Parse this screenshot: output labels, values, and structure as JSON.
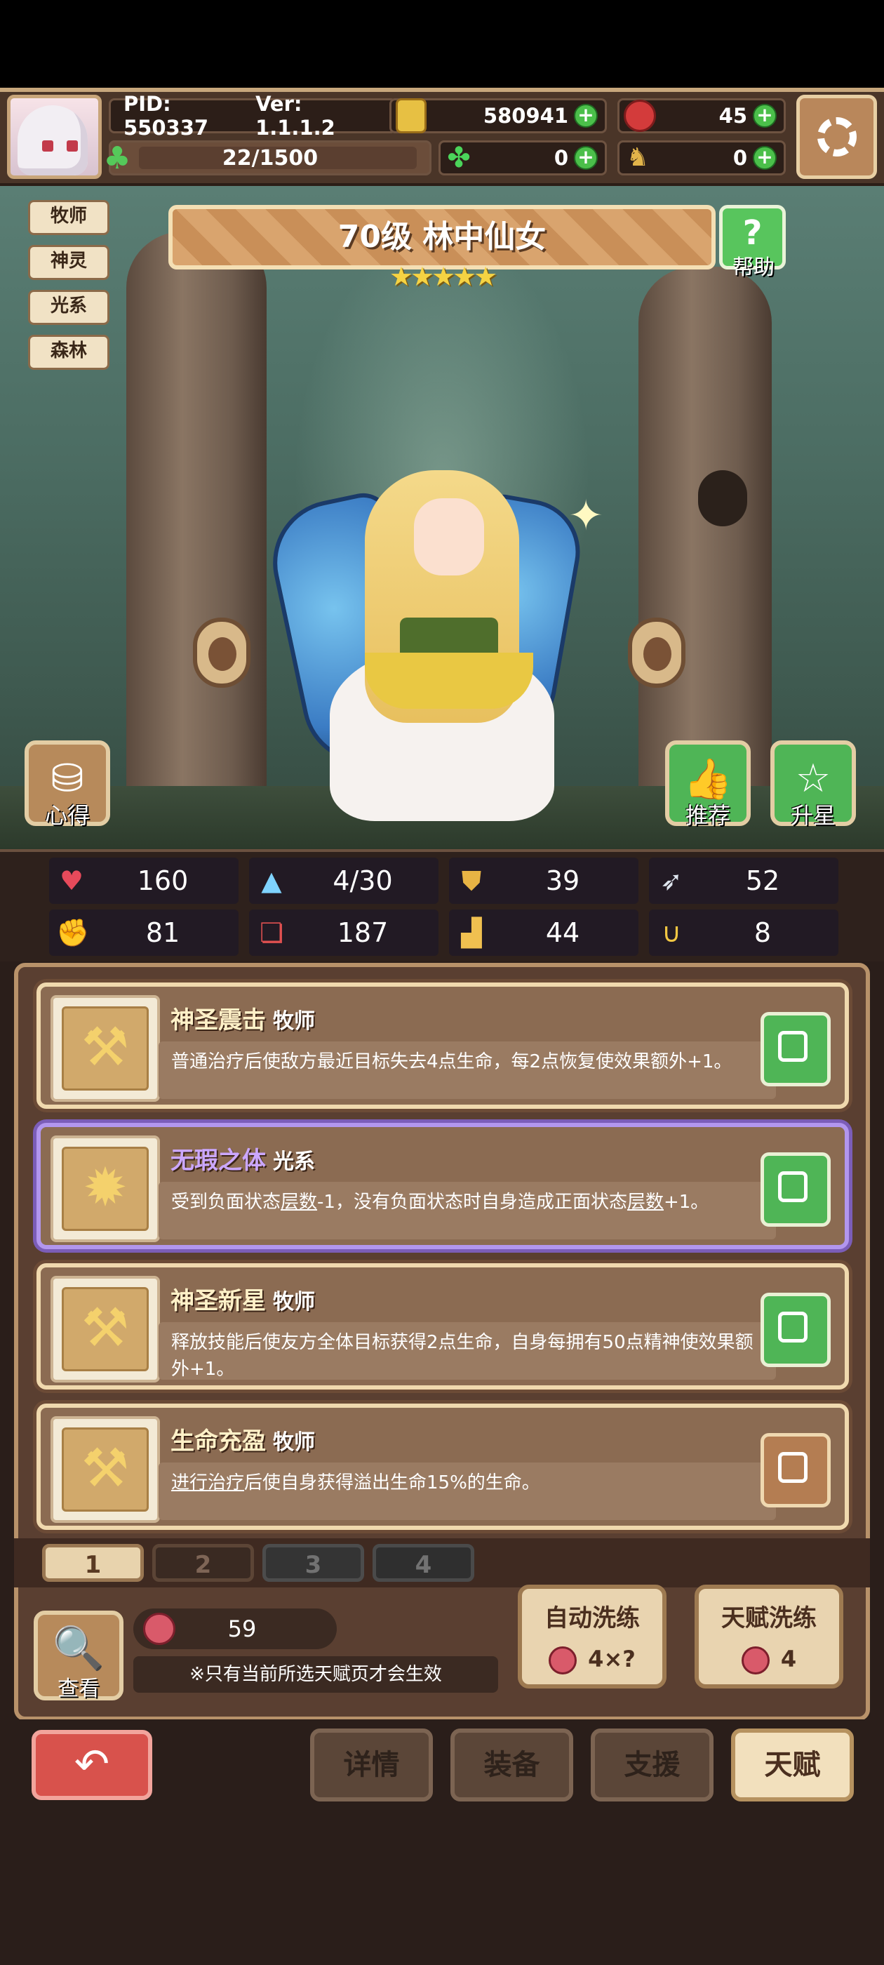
{
  "header": {
    "pid": "PID: 550337",
    "version": "Ver: 1.1.1.2",
    "coins": "580941",
    "gems": "45",
    "xp": "22/1500",
    "clovers": "0",
    "horseshoes": "0"
  },
  "tags": [
    "牧师",
    "神灵",
    "光系",
    "森林"
  ],
  "hero": {
    "title": "70级 林中仙女",
    "stars": "★★★★★",
    "help": "帮助"
  },
  "scene_buttons": {
    "xinde": "心得",
    "tuijian": "推荐",
    "shengxing": "升星"
  },
  "stats": [
    {
      "icon": "heart-icon",
      "value": "160"
    },
    {
      "icon": "water-drop-icon",
      "value": "4/30"
    },
    {
      "icon": "shield-icon",
      "value": "39"
    },
    {
      "icon": "wing-icon",
      "value": "52"
    },
    {
      "icon": "fist-icon",
      "value": "81"
    },
    {
      "icon": "book-icon",
      "value": "187"
    },
    {
      "icon": "boot-icon",
      "value": "44"
    },
    {
      "icon": "magnet-icon",
      "value": "8"
    }
  ],
  "talents": [
    {
      "name": "神圣震击",
      "type": "牧师",
      "desc": "普通治疗后使敌方最近目标失去4点生命，每2点恢复使效果额外+1。"
    },
    {
      "name": "无瑕之体",
      "type": "光系",
      "desc_a": "受到负面状态",
      "desc_b": "层数",
      "desc_c": "-1，没有负面状态时自身造成正面状态",
      "desc_d": "层数",
      "desc_e": "+1。"
    },
    {
      "name": "神圣新星",
      "type": "牧师",
      "desc": "释放技能后使友方全体目标获得2点生命，自身每拥有50点精神使效果额外+1。"
    },
    {
      "name": "生命充盈",
      "type": "牧师",
      "desc_a": "进行治疗",
      "desc_b": "后使自身获得溢出生命15%的生命。"
    }
  ],
  "pages": [
    "1",
    "2",
    "3",
    "4"
  ],
  "bottom_panel": {
    "view": "查看",
    "fruit_count": "59",
    "note": "※只有当前所选天赋页才会生效",
    "auto_reroll": {
      "label": "自动洗练",
      "cost": "4×?"
    },
    "talent_reroll": {
      "label": "天赋洗练",
      "cost": "4"
    }
  },
  "nav": {
    "details": "详情",
    "equipment": "装备",
    "support": "支援",
    "talent": "天赋"
  },
  "colors": {
    "accent_green": "#4fb556",
    "selected_purple": "#b296ee",
    "back_red": "#d8524c"
  }
}
